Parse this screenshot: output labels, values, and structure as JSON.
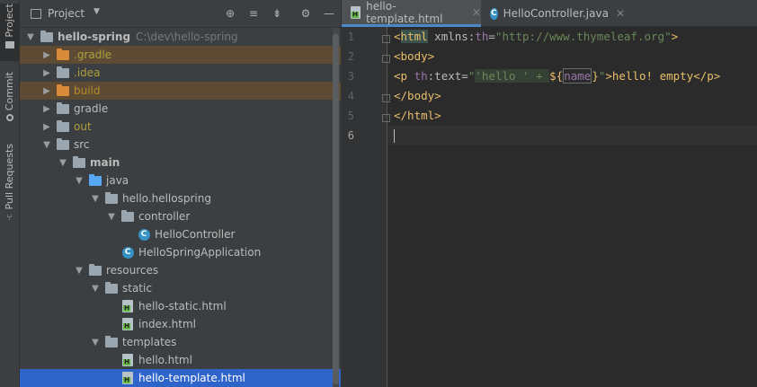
{
  "sidebar": {
    "tabs": [
      {
        "label": "Project"
      },
      {
        "label": "Commit"
      },
      {
        "label": "Pull Requests"
      }
    ]
  },
  "project_panel": {
    "title": "Project",
    "tree": [
      {
        "label": "hello-spring",
        "path": "C:\\dev\\hello-spring"
      },
      {
        "label": ".gradle"
      },
      {
        "label": ".idea"
      },
      {
        "label": "build"
      },
      {
        "label": "gradle"
      },
      {
        "label": "out"
      },
      {
        "label": "src"
      },
      {
        "label": "main"
      },
      {
        "label": "java"
      },
      {
        "label": "hello.hellospring"
      },
      {
        "label": "controller"
      },
      {
        "label": "HelloController"
      },
      {
        "label": "HelloSpringApplication"
      },
      {
        "label": "resources"
      },
      {
        "label": "static"
      },
      {
        "label": "hello-static.html"
      },
      {
        "label": "index.html"
      },
      {
        "label": "templates"
      },
      {
        "label": "hello.html"
      },
      {
        "label": "hello-template.html"
      }
    ]
  },
  "editor": {
    "tabs": [
      {
        "label": "hello-template.html",
        "active": true
      },
      {
        "label": "HelloController.java",
        "active": false
      }
    ],
    "lines": {
      "l1": {
        "open": "<",
        "tag": "html",
        "sp": " ",
        "attr": "xmlns:",
        "ns": "th",
        "eq": "=",
        "val": "\"http://www.thymeleaf.org\"",
        "close": ">"
      },
      "l2": {
        "text": "<body>"
      },
      "l3": {
        "open": "<",
        "tag": "p",
        "sp": " ",
        "ns": "th",
        "attr": ":text=",
        "q1": "\"",
        "s1": "'hello ' + ",
        "expr_open": "${",
        "expr_name": "name",
        "expr_close": "}",
        "q2": "\"",
        "rest": ">hello! empty</p>"
      },
      "l4": {
        "text": "</body>"
      },
      "l5": {
        "text": "</html>"
      }
    },
    "line_numbers": [
      "1",
      "2",
      "3",
      "4",
      "5",
      "6"
    ],
    "current_line": "6"
  },
  "colors": {
    "editor_bg": "#2b2b2b",
    "panel_bg": "#3c3f41",
    "selection": "#2f65ca",
    "tag": "#e8bf6a",
    "string": "#6a8759"
  }
}
